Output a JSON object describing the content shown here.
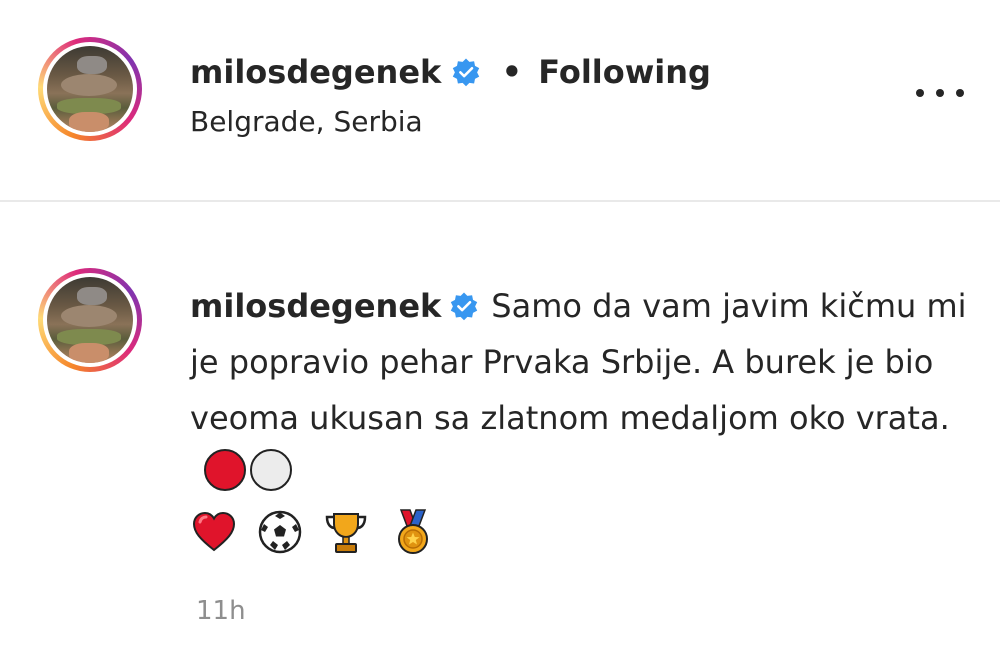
{
  "post_header": {
    "username": "milosdegenek",
    "separator": "•",
    "follow_status": "Following",
    "location": "Belgrade, Serbia",
    "more_icon": "more-horizontal-icon"
  },
  "comment": {
    "username": "milosdegenek",
    "text": "Samo da vam javim kičmu mi je popravio pehar Prvaka Srbije. A burek je bio veoma ukusan sa zlatnom medaljom oko vrata.",
    "emojis": [
      "red-circle",
      "white-circle",
      "red-heart",
      "soccer-ball",
      "trophy",
      "sports-medal"
    ],
    "timestamp": "11h"
  },
  "colors": {
    "text": "#262626",
    "verified_blue": "#3897f0",
    "muted": "#8e8e8e",
    "divider": "#e9e9e9"
  }
}
